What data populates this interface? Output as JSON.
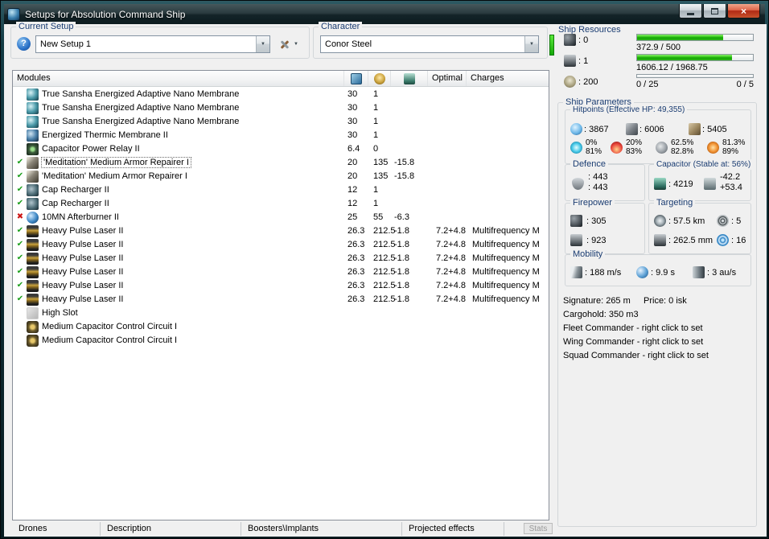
{
  "window": {
    "title": "Setups for Absolution Command Ship"
  },
  "setup": {
    "group_label": "Current Setup",
    "value": "New Setup 1"
  },
  "character": {
    "group_label": "Character",
    "value": "Conor Steel"
  },
  "resources": {
    "group_label": "Ship Resources",
    "turrets": ": 0",
    "launchers": ": 1",
    "calibration": ": 200",
    "cpu_text": "372.9 / 500",
    "cpu_pct": 74.6,
    "pg_text": "1606.12 / 1968.75",
    "pg_pct": 81.6,
    "drones_used": "0 / 25",
    "drones_bay": "0 / 5",
    "drone_pct": 0
  },
  "table": {
    "columns": {
      "modules": "Modules",
      "optimal": "Optimal",
      "charges": "Charges"
    },
    "rows": [
      {
        "status": "",
        "icon": "membrane",
        "name": "True Sansha Energized Adaptive Nano Membrane",
        "cpu": "30",
        "pg": "1",
        "cap": "",
        "optimal": "",
        "charges": "",
        "selected": false
      },
      {
        "status": "",
        "icon": "membrane",
        "name": "True Sansha Energized Adaptive Nano Membrane",
        "cpu": "30",
        "pg": "1",
        "cap": "",
        "optimal": "",
        "charges": "",
        "selected": false
      },
      {
        "status": "",
        "icon": "membrane",
        "name": "True Sansha Energized Adaptive Nano Membrane",
        "cpu": "30",
        "pg": "1",
        "cap": "",
        "optimal": "",
        "charges": "",
        "selected": false
      },
      {
        "status": "",
        "icon": "membrane2",
        "name": "Energized Thermic Membrane II",
        "cpu": "30",
        "pg": "1",
        "cap": "",
        "optimal": "",
        "charges": "",
        "selected": false
      },
      {
        "status": "",
        "icon": "relay",
        "name": "Capacitor Power Relay II",
        "cpu": "6.4",
        "pg": "0",
        "cap": "",
        "optimal": "",
        "charges": "",
        "selected": false
      },
      {
        "status": "ok",
        "icon": "repairer",
        "name": "'Meditation' Medium Armor Repairer I",
        "cpu": "20",
        "pg": "135",
        "cap": "-15.8",
        "optimal": "",
        "charges": "",
        "selected": true
      },
      {
        "status": "ok",
        "icon": "repairer",
        "name": "'Meditation' Medium Armor Repairer I",
        "cpu": "20",
        "pg": "135",
        "cap": "-15.8",
        "optimal": "",
        "charges": "",
        "selected": false
      },
      {
        "status": "ok",
        "icon": "recharger",
        "name": "Cap Recharger II",
        "cpu": "12",
        "pg": "1",
        "cap": "",
        "optimal": "",
        "charges": "",
        "selected": false
      },
      {
        "status": "ok",
        "icon": "recharger",
        "name": "Cap Recharger II",
        "cpu": "12",
        "pg": "1",
        "cap": "",
        "optimal": "",
        "charges": "",
        "selected": false
      },
      {
        "status": "bad",
        "icon": "afterburner",
        "name": "10MN Afterburner II",
        "cpu": "25",
        "pg": "55",
        "cap": "-6.3",
        "optimal": "",
        "charges": "",
        "selected": false
      },
      {
        "status": "ok",
        "icon": "laser",
        "name": "Heavy Pulse Laser II",
        "cpu": "26.3",
        "pg": "212.5",
        "cap": "-1.8",
        "optimal": "7.2+4.8",
        "charges": "Multifrequency M",
        "selected": false
      },
      {
        "status": "ok",
        "icon": "laser",
        "name": "Heavy Pulse Laser II",
        "cpu": "26.3",
        "pg": "212.5",
        "cap": "-1.8",
        "optimal": "7.2+4.8",
        "charges": "Multifrequency M",
        "selected": false
      },
      {
        "status": "ok",
        "icon": "laser",
        "name": "Heavy Pulse Laser II",
        "cpu": "26.3",
        "pg": "212.5",
        "cap": "-1.8",
        "optimal": "7.2+4.8",
        "charges": "Multifrequency M",
        "selected": false
      },
      {
        "status": "ok",
        "icon": "laser",
        "name": "Heavy Pulse Laser II",
        "cpu": "26.3",
        "pg": "212.5",
        "cap": "-1.8",
        "optimal": "7.2+4.8",
        "charges": "Multifrequency M",
        "selected": false
      },
      {
        "status": "ok",
        "icon": "laser",
        "name": "Heavy Pulse Laser II",
        "cpu": "26.3",
        "pg": "212.5",
        "cap": "-1.8",
        "optimal": "7.2+4.8",
        "charges": "Multifrequency M",
        "selected": false
      },
      {
        "status": "ok",
        "icon": "laser",
        "name": "Heavy Pulse Laser II",
        "cpu": "26.3",
        "pg": "212.5",
        "cap": "-1.8",
        "optimal": "7.2+4.8",
        "charges": "Multifrequency M",
        "selected": false
      },
      {
        "status": "",
        "icon": "highslot",
        "name": "High Slot",
        "cpu": "",
        "pg": "",
        "cap": "",
        "optimal": "",
        "charges": "",
        "selected": false
      },
      {
        "status": "",
        "icon": "rig",
        "name": "Medium Capacitor Control Circuit I",
        "cpu": "",
        "pg": "",
        "cap": "",
        "optimal": "",
        "charges": "",
        "selected": false
      },
      {
        "status": "",
        "icon": "rig",
        "name": "Medium Capacitor Control Circuit I",
        "cpu": "",
        "pg": "",
        "cap": "",
        "optimal": "",
        "charges": "",
        "selected": false
      }
    ]
  },
  "params": {
    "group_label": "Ship Parameters",
    "hitpoints": {
      "label": "Hitpoints (Effective HP: 49,355)",
      "shield": ": 3867",
      "armor": ": 6006",
      "hull": ": 5405",
      "resists": [
        {
          "top": "0%",
          "bottom": "81%"
        },
        {
          "top": "20%",
          "bottom": "83%"
        },
        {
          "top": "62.5%",
          "bottom": "82.8%"
        },
        {
          "top": "81.3%",
          "bottom": "89%"
        }
      ]
    },
    "defence": {
      "label": "Defence",
      "top": ": 443",
      "bottom": ": 443"
    },
    "capacitor": {
      "label": "Capacitor (Stable at: 56%)",
      "amount": ": 4219",
      "peak": "-42.2",
      "recharge": "+53.4"
    },
    "firepower": {
      "label": "Firepower",
      "volley": ": 305",
      "dps": ": 923"
    },
    "targeting": {
      "label": "Targeting",
      "range": ": 57.5 km",
      "targets": ": 5",
      "resolution": ": 262.5 mm",
      "sensor": ": 16"
    },
    "mobility": {
      "label": "Mobility",
      "speed": ": 188 m/s",
      "align": ": 9.9 s",
      "warp": ": 3 au/s"
    },
    "info": {
      "signature": "Signature: 265 m",
      "price": "Price: 0 isk",
      "cargohold": "Cargohold: 350 m3",
      "fleet": "Fleet Commander - right click to set",
      "wing": "Wing Commander - right click to set",
      "squad": "Squad Commander - right click to set"
    }
  },
  "tabs": [
    "Drones",
    "Description",
    "Boosters\\Implants",
    "Projected effects"
  ],
  "stats_label": "Stats"
}
